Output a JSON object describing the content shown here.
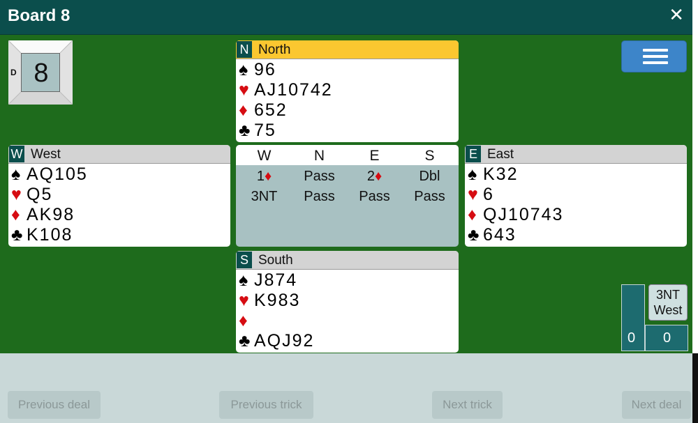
{
  "window": {
    "title": "Board 8",
    "close_glyph": "✕"
  },
  "dealer": {
    "board_number": "8",
    "dealer_letter": "D"
  },
  "hands": {
    "north": {
      "badge": "N",
      "name": "North",
      "spades": "96",
      "hearts": "AJ10742",
      "diamonds": "652",
      "clubs": "75"
    },
    "west": {
      "badge": "W",
      "name": "West",
      "spades": "AQ105",
      "hearts": "Q5",
      "diamonds": "AK98",
      "clubs": "K108"
    },
    "east": {
      "badge": "E",
      "name": "East",
      "spades": "K32",
      "hearts": "6",
      "diamonds": "QJ10743",
      "clubs": "643"
    },
    "south": {
      "badge": "S",
      "name": "South",
      "spades": "J874",
      "hearts": "K983",
      "diamonds": "",
      "clubs": "AQJ92"
    }
  },
  "suit_symbols": {
    "spades": "♠",
    "hearts": "♥",
    "diamonds": "♦",
    "clubs": "♣"
  },
  "auction": {
    "headers": [
      "W",
      "N",
      "E",
      "S"
    ],
    "row1": {
      "w_level": "1",
      "n": "Pass",
      "e_level": "2",
      "s": "Dbl"
    },
    "row2": {
      "w": "3NT",
      "n": "Pass",
      "e": "Pass",
      "s": "Pass"
    }
  },
  "contract": {
    "bid": "3NT",
    "declarer": "West"
  },
  "score": {
    "left": "0",
    "right": "0"
  },
  "nav": {
    "previous_deal": "Previous deal",
    "previous_trick": "Previous trick",
    "next_trick": "Next trick",
    "next_deal": "Next deal"
  },
  "colors": {
    "table_green": "#1e6b1c",
    "title_bar": "#0b4e4c",
    "active_hand": "#fbc730",
    "menu_blue": "#3d85c9",
    "red_suit": "#d60c12"
  },
  "icons": {
    "menu": "hamburger-icon",
    "close": "close-icon"
  }
}
